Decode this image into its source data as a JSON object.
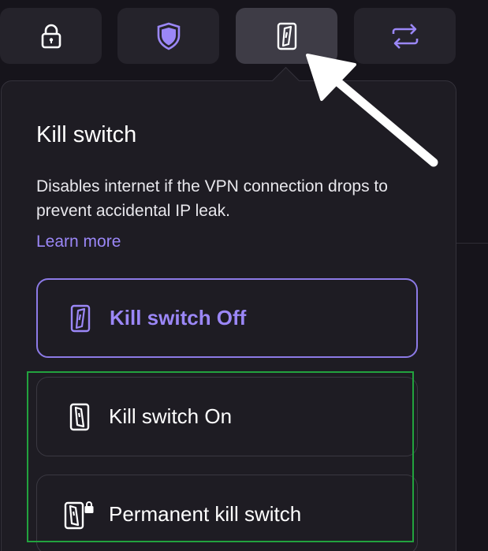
{
  "toolbar": {
    "buttons": [
      {
        "icon": "lock-icon",
        "active": false
      },
      {
        "icon": "shield-icon",
        "active": false
      },
      {
        "icon": "kill-switch-icon",
        "active": true
      },
      {
        "icon": "split-tunneling-arrows-icon",
        "active": false
      }
    ]
  },
  "panel": {
    "title": "Kill switch",
    "description": "Disables internet if the VPN connection drops to prevent accidental IP leak.",
    "learn_more": "Learn more",
    "options": {
      "off": {
        "label": "Kill switch Off",
        "selected": true
      },
      "on": {
        "label": "Kill switch On",
        "selected": false
      },
      "permanent": {
        "label": "Permanent kill switch",
        "selected": false
      }
    }
  },
  "colors": {
    "accent": "#9b87f7",
    "panel_bg": "#1e1c23",
    "highlight": "#22a23e",
    "annotation_arrow": "#ffffff"
  }
}
